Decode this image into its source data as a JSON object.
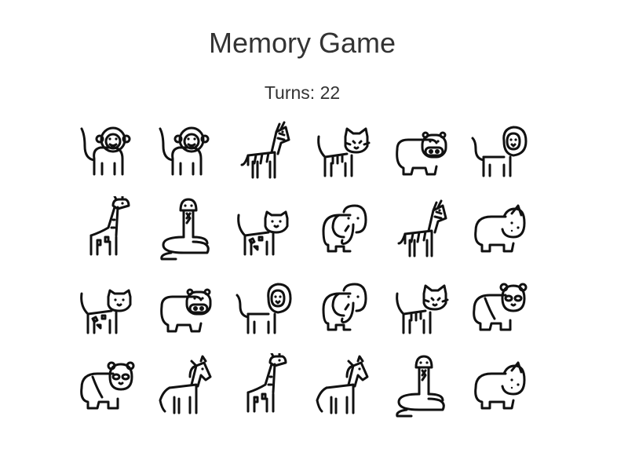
{
  "title": "Memory Game",
  "turns": {
    "label": "Turns:",
    "count": 22
  },
  "board": {
    "columns": 6,
    "rows": 4,
    "cards": [
      "monkey-icon",
      "monkey-icon",
      "zebra-icon",
      "tiger-icon",
      "hippo-icon",
      "lion-icon",
      "giraffe-icon",
      "snake-icon",
      "leopard-icon",
      "elephant-icon",
      "zebra-icon",
      "rhino-icon",
      "leopard-icon",
      "hippo-icon",
      "lion-icon",
      "elephant-icon",
      "tiger-icon",
      "panda-icon",
      "panda-icon",
      "horse-icon",
      "giraffe-icon",
      "horse-icon",
      "snake-icon",
      "rhino-icon"
    ]
  }
}
